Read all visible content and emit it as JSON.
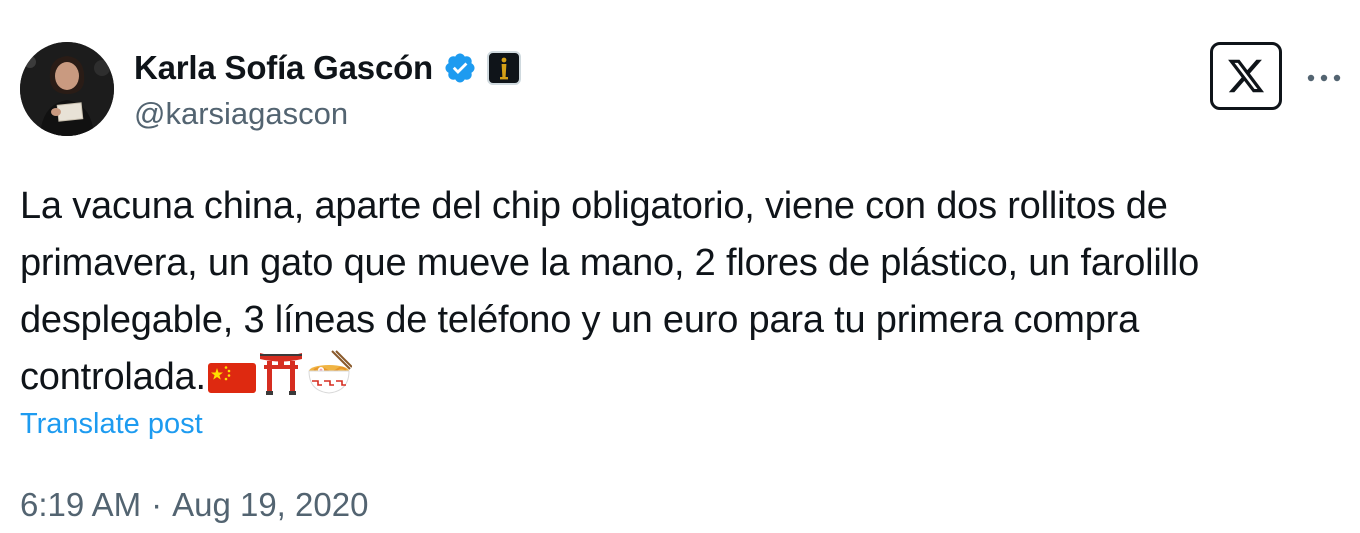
{
  "author": {
    "display_name": "Karla Sofía Gascón",
    "handle": "@karsiagascon"
  },
  "tweet": {
    "lines": [
      "La vacuna china, aparte del chip obligatorio, viene con dos rollitos de",
      "primavera, un gato que mueve la mano, 2 flores de plástico, un farolillo",
      "desplegable, 3 líneas de teléfono y un euro para tu primera compra",
      "controlada."
    ],
    "emojis": [
      "flag-china-icon",
      "torii-gate-icon",
      "ramen-bowl-icon"
    ]
  },
  "translate_label": "Translate post",
  "timestamp": {
    "time": "6:19 AM",
    "separator": "·",
    "date": "Aug 19, 2020"
  },
  "colors": {
    "verified": "#1d9bf0",
    "link": "#1d9bf0",
    "secondary_text": "#536471",
    "primary_text": "#0f1419"
  }
}
